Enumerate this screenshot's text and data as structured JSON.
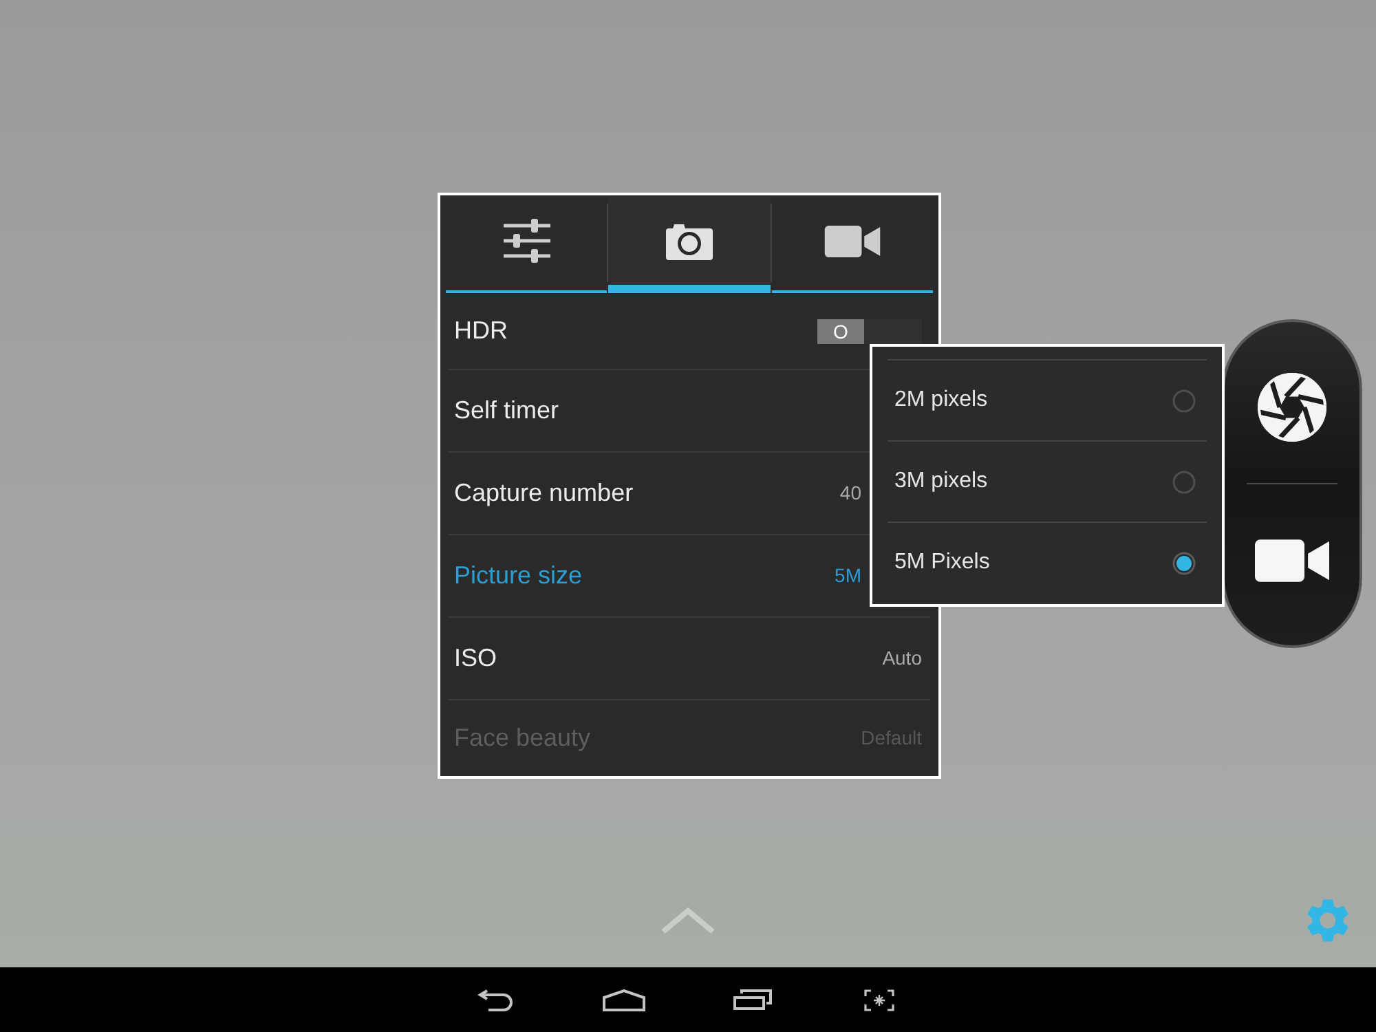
{
  "settings_panel": {
    "tabs": [
      {
        "selected": false
      },
      {
        "selected": true
      },
      {
        "selected": false
      }
    ],
    "rows": [
      {
        "kind": "switch",
        "label": "HDR",
        "on": false,
        "switch_label": "O",
        "selected": false,
        "disabled": false
      },
      {
        "kind": "value",
        "label": "Self timer",
        "selected": false,
        "disabled": false
      },
      {
        "kind": "value",
        "label": "Capture number",
        "value": "40",
        "selected": false,
        "disabled": false
      },
      {
        "kind": "value",
        "label": "Picture size",
        "value": "5M",
        "selected": true,
        "disabled": false
      },
      {
        "kind": "value",
        "label": "ISO",
        "value": "Auto",
        "selected": false,
        "disabled": false
      },
      {
        "kind": "value",
        "label": "Face beauty",
        "value": "Default",
        "selected": false,
        "disabled": true
      }
    ]
  },
  "picture_size_popup": {
    "options": [
      {
        "label": "2M pixels",
        "selected": false
      },
      {
        "label": "3M pixels",
        "selected": false
      },
      {
        "label": "5M Pixels",
        "selected": true
      }
    ]
  }
}
